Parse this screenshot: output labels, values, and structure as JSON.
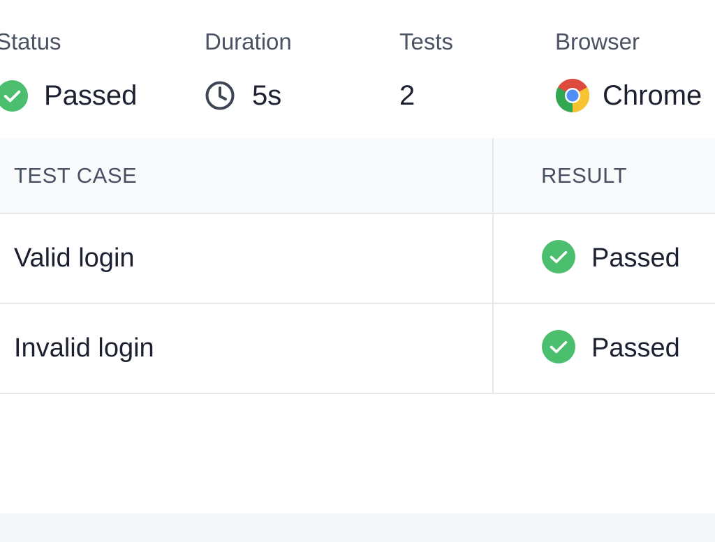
{
  "summary": {
    "status": {
      "label": "Status",
      "value": "Passed",
      "icon": "check-circle-icon"
    },
    "duration": {
      "label": "Duration",
      "value": "5s",
      "icon": "clock-icon"
    },
    "tests": {
      "label": "Tests",
      "value": "2"
    },
    "browser": {
      "label": "Browser",
      "value": "Chrome",
      "icon": "chrome-icon"
    }
  },
  "table": {
    "headers": {
      "test_case": "TEST CASE",
      "result": "RESULT"
    },
    "rows": [
      {
        "test_case": "Valid login",
        "result": "Passed",
        "result_icon": "check-circle-icon"
      },
      {
        "test_case": "Invalid login",
        "result": "Passed",
        "result_icon": "check-circle-icon"
      }
    ]
  },
  "colors": {
    "success": "#4cbf6f",
    "border": "#e6e8eb",
    "header_bg": "#f9fafb",
    "label_text": "#4a5263",
    "value_text": "#1c2030"
  }
}
